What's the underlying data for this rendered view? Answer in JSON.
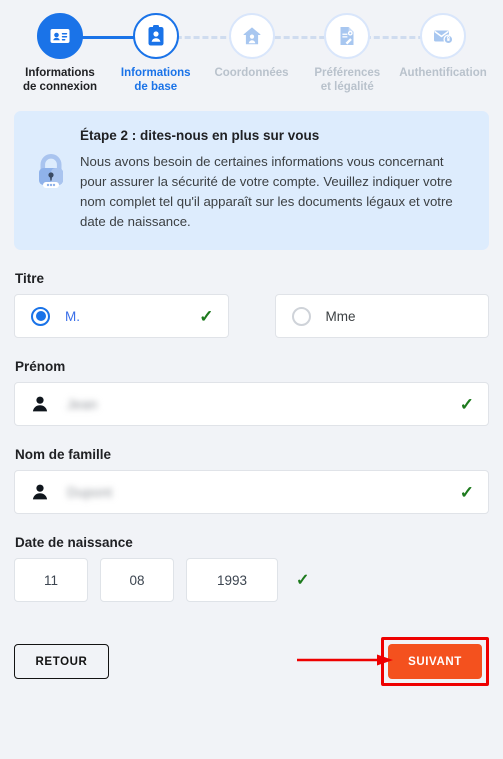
{
  "stepper": {
    "steps": [
      {
        "label": "Informations\nde connexion",
        "label_line1": "Informations",
        "label_line2": "de connexion",
        "state": "done",
        "icon": "id-card-icon"
      },
      {
        "label": "Informations\nde base",
        "label_line1": "Informations",
        "label_line2": "de base",
        "state": "current",
        "icon": "badge-icon"
      },
      {
        "label": "Coordonnées",
        "label_line1": "Coordonnées",
        "label_line2": "",
        "state": "upcoming",
        "icon": "home-icon"
      },
      {
        "label": "Préférences\net légalité",
        "label_line1": "Préférences",
        "label_line2": "et légalité",
        "state": "upcoming",
        "icon": "document-settings-icon"
      },
      {
        "label": "Authentification",
        "label_line1": "Authentification",
        "label_line2": "",
        "state": "upcoming",
        "icon": "envelope-lock-icon"
      }
    ]
  },
  "infobox": {
    "icon": "padlock-icon",
    "title": "Étape 2 : dites-nous en plus sur vous",
    "body": "Nous avons besoin de certaines informations vous concernant pour assurer la sécurité de votre compte. Veuillez indiquer votre nom complet tel qu'il apparaît sur les documents légaux et votre date de naissance."
  },
  "form": {
    "title_field": {
      "label": "Titre",
      "options": [
        {
          "label": "M.",
          "checked": true,
          "validated": true
        },
        {
          "label": "Mme",
          "checked": false,
          "validated": false
        }
      ]
    },
    "first_name": {
      "label": "Prénom",
      "value": "Jean",
      "icon": "person-icon",
      "redacted": true,
      "validated": true
    },
    "last_name": {
      "label": "Nom de famille",
      "value": "Dupont",
      "icon": "person-icon",
      "redacted": true,
      "validated": true
    },
    "birth_date": {
      "label": "Date de naissance",
      "day": "11",
      "month": "08",
      "year": "1993",
      "validated": true
    }
  },
  "footer": {
    "back_label": "RETOUR",
    "next_label": "SUIVANT",
    "annotation": "red-arrow-and-box-highlight"
  },
  "colors": {
    "page_background": "#f1f3f7",
    "accent_blue": "#1a73e8",
    "infobox_background": "#ddecfd",
    "check_green": "#1d7a1d",
    "next_button_orange": "#f4511e",
    "annotation_red": "#ee0000",
    "muted_gray": "#b9c2cc"
  }
}
